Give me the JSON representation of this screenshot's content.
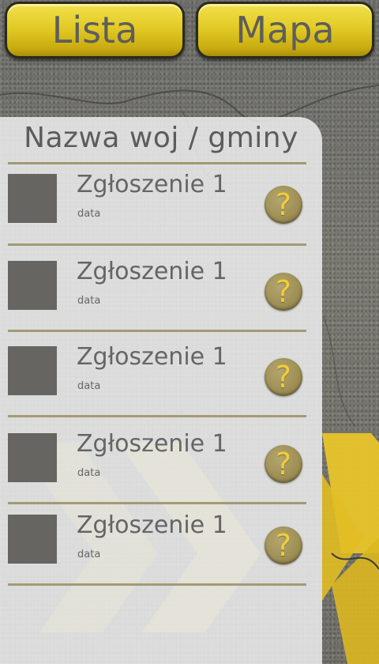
{
  "tabs": {
    "list_label": "Lista",
    "map_label": "Mapa"
  },
  "panel": {
    "title": "Nazwa woj / gminy"
  },
  "items": [
    {
      "title": "Zgłoszenie 1",
      "date": "data",
      "help": "?"
    },
    {
      "title": "Zgłoszenie 1",
      "date": "data",
      "help": "?"
    },
    {
      "title": "Zgłoszenie 1",
      "date": "data",
      "help": "?"
    },
    {
      "title": "Zgłoszenie 1",
      "date": "data",
      "help": "?"
    },
    {
      "title": "Zgłoszenie 1",
      "date": "data",
      "help": "?"
    }
  ],
  "colors": {
    "button_yellow": "#e3cb26",
    "rule": "#a39a75",
    "thumb": "#676562",
    "text": "#5c5c5c",
    "road_marking": "#e8c42a"
  }
}
